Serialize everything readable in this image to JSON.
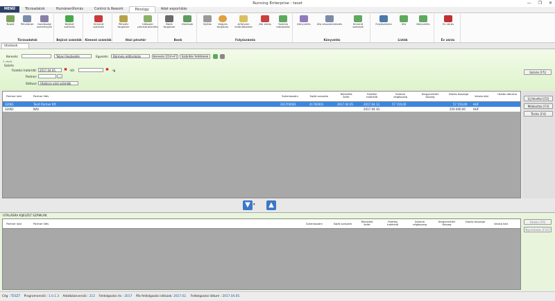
{
  "window": {
    "title": "Running Enterprise - teszt"
  },
  "ribbon_tabs": [
    "Törzsadatok",
    "Humánerőforrás",
    "Control & Rework",
    "Pénzügy",
    "Adat exportálás"
  ],
  "menu_label": "MENÜ",
  "active_tab": "Pénzügy",
  "ribbon_groups": [
    {
      "title": "Törzsadatok",
      "buttons": [
        "Napló",
        "Pénztárak",
        "Gazdasági események"
      ]
    },
    {
      "title": "Bejövő számlák",
      "buttons": [
        "Bejövő számlák"
      ]
    },
    {
      "title": "Kimenő számlák",
      "buttons": [
        "Kimenő számlák"
      ]
    },
    {
      "title": "Házi pénztár",
      "buttons": [
        "Pénztár forgalom",
        "Időszaki pénztárjelentés"
      ]
    },
    {
      "title": "Bank",
      "buttons": [
        "Bank forgalom",
        "Utalások"
      ]
    },
    {
      "title": "Folyószámla",
      "buttons": [
        "Nyitás",
        "Vegyes forgalom",
        "Arfolyam különbözetek",
        "Áfa zárás",
        "Számla módosítás"
      ]
    },
    {
      "title": "Könyvelés",
      "buttons": [
        "Könyvelés",
        "Áfa visszarendezés",
        "Kimenő számlák"
      ]
    },
    {
      "title": "Listák",
      "buttons": [
        "Folyószámla",
        "Áfa",
        "Könyvelés"
      ]
    },
    {
      "title": "Év zárás",
      "buttons": [
        "Év zárás"
      ]
    }
  ],
  "doc_tab": "Utalások",
  "filter": {
    "keresés_label": "Keresés:",
    "search_value": "",
    "mode": "Teljes illeszkedés",
    "egyezes_label": "Egyezés:",
    "egyezes_value": "Bármely előfordulás",
    "kereses_btn": "Keresés [Ctrl+F]",
    "szukites_btn": "Szűkítés feltételek",
    "sub_label": "2 nézet",
    "szures_label": "Szűrés",
    "fizetesi_label": "Fizetési határidő:",
    "date_from": "2017.04.05.",
    "date_sep": "-tól",
    "date_to_sep": "-ig",
    "partner_label": "Partner:",
    "statusz_label": "Státusz:",
    "statusz_value": "Utalásra váró számlák",
    "szures_btn": "Szűrés [F5]"
  },
  "grid_headers": [
    "Partner kód",
    "Partner Név",
    "Számlaszám",
    "Saját sorszám",
    "Teljesítés kelte",
    "Fizetési határidő",
    "Számla végösszeg",
    "Kiegyenlített összeg",
    "Utalás összege",
    "Valuta kód",
    "Utalás dátuma"
  ],
  "rows": [
    {
      "kod": "32061",
      "nev": "Teszt Partner Kft",
      "szamla": "201700001",
      "sajat": "41700001",
      "telj": "2017.04.05.",
      "hatarido": "2017.04.13.",
      "vegosszeg": "57 150,00",
      "kiegy": "",
      "utalas": "57 150,00",
      "valuta": "HUF",
      "datum": ""
    },
    {
      "kod": "32062",
      "nev": "NAV",
      "szamla": "",
      "sajat": "",
      "telj": "",
      "hatarido": "2017.04.10.",
      "vegosszeg": "",
      "kiegy": "",
      "utalas": "250 000,00",
      "valuta": "HUF",
      "datum": ""
    }
  ],
  "side_buttons": [
    "Új felvétel [F2]",
    "Módosítás [F3]",
    "Törlés [F4]"
  ],
  "lower": {
    "title": "UTALÁSRA KIJELÖLT SZÁMLÁK",
    "headers": [
      "Partner kód",
      "Partner Név",
      "Számlaszám",
      "Saját sorszám",
      "Teljesítés kelte",
      "Fizetési határidő",
      "Számla végösszeg",
      "Kiegyenlített összeg",
      "Utalás összege",
      "Valuta kód"
    ],
    "buttons": [
      "Utalás [F6]",
      "Nyomtatás [F10]"
    ]
  },
  "status": {
    "ceg_l": "Cég :",
    "ceg": "TESZT",
    "prog_l": "Programverzió :",
    "prog": "1.0.1.3",
    "adat_l": "Adatbázisverzió :",
    "adat": "212",
    "ev_l": "Feldolgozási év :",
    "ev": "2017",
    "afa_l": "Áfa feldolgozási időszak:",
    "afa": "2017.02.",
    "datum_l": "Feldolgozási dátum :",
    "datum": "2017.04.05."
  }
}
